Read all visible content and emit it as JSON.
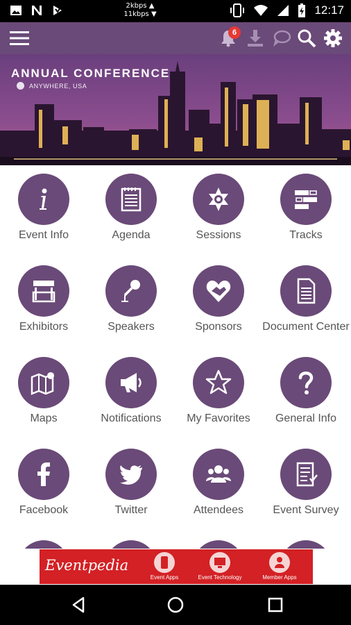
{
  "status_bar": {
    "speed_up": "2kbps ▲",
    "speed_down": "11kbps ▼",
    "time": "12:17",
    "left_icons": [
      "image-icon",
      "n-icon",
      "download-app-icon"
    ],
    "right_icons": [
      "vibrate-icon",
      "wifi-icon",
      "signal-icon",
      "battery-icon"
    ]
  },
  "app_bar": {
    "notification_count": "6",
    "icons": [
      "menu-icon",
      "bell-icon",
      "download-icon",
      "chat-icon",
      "search-icon",
      "gear-icon"
    ]
  },
  "banner": {
    "title": "ANNUAL CONFERENCE",
    "location": "ANYWHERE, USA"
  },
  "grid": {
    "items": [
      {
        "label": "Event Info",
        "icon": "info-icon"
      },
      {
        "label": "Agenda",
        "icon": "agenda-icon"
      },
      {
        "label": "Sessions",
        "icon": "sessions-icon"
      },
      {
        "label": "Tracks",
        "icon": "tracks-icon"
      },
      {
        "label": "Exhibitors",
        "icon": "exhibitor-booth-icon"
      },
      {
        "label": "Speakers",
        "icon": "microphone-icon"
      },
      {
        "label": "Sponsors",
        "icon": "handshake-heart-icon"
      },
      {
        "label": "Document Center",
        "icon": "document-icon"
      },
      {
        "label": "Maps",
        "icon": "map-icon"
      },
      {
        "label": "Notifications",
        "icon": "megaphone-icon"
      },
      {
        "label": "My Favorites",
        "icon": "star-icon"
      },
      {
        "label": "General Info",
        "icon": "question-icon"
      },
      {
        "label": "Facebook",
        "icon": "facebook-icon"
      },
      {
        "label": "Twitter",
        "icon": "twitter-icon"
      },
      {
        "label": "Attendees",
        "icon": "attendees-icon"
      },
      {
        "label": "Event Survey",
        "icon": "survey-icon"
      }
    ]
  },
  "ad": {
    "brand": "Eventpedia",
    "items": [
      "Event Apps",
      "Event Technology",
      "Member Apps"
    ]
  },
  "nav_bar": {
    "icons": [
      "back-icon",
      "home-icon",
      "recents-icon"
    ]
  },
  "colors": {
    "primary": "#6a4a78",
    "ad_red": "#d32125",
    "badge": "#e53935",
    "label_text": "#555555"
  }
}
